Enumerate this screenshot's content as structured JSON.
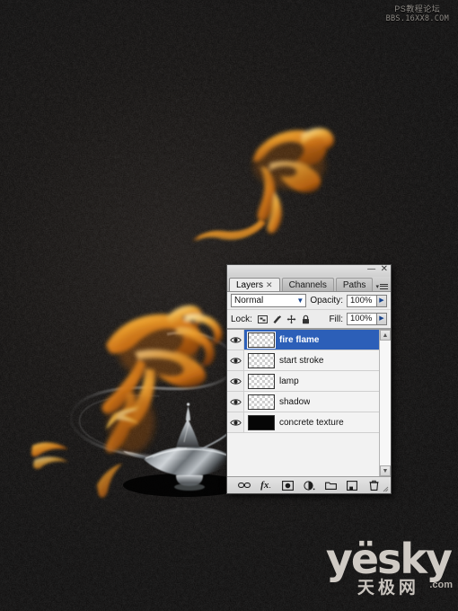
{
  "artwork": {
    "title": "Genie lamp with fire flames composition",
    "background_color": "#0a0807",
    "flame_colors": [
      "#f7c05a",
      "#e8952a",
      "#c96c14",
      "#7a3c08"
    ],
    "lamp_color": "#b9bcc0",
    "stroke_color": "#5a5a5a"
  },
  "watermark_top": {
    "line1": "PS教程论坛",
    "line2": "BBS.16XX8.COM"
  },
  "watermark_logo": {
    "brand": "yësky",
    "suffix": ".com",
    "chinese": "天极网"
  },
  "panel": {
    "window_controls": {
      "minimize": "—",
      "close": "✕"
    },
    "tabs": [
      {
        "label": "Layers",
        "active": true,
        "closable": true,
        "close_glyph": "✕"
      },
      {
        "label": "Channels",
        "active": false,
        "closable": false
      },
      {
        "label": "Paths",
        "active": false,
        "closable": false
      }
    ],
    "menu_icon": "panel-menu-icon",
    "blend_mode": {
      "value": "Normal",
      "dropdown_glyph": "▼"
    },
    "opacity": {
      "label": "Opacity:",
      "value": "100%",
      "spinner_glyph": "▶"
    },
    "lock": {
      "label": "Lock:",
      "icons": [
        {
          "name": "lock-transparent-pixels-icon"
        },
        {
          "name": "lock-image-pixels-icon"
        },
        {
          "name": "lock-position-icon"
        },
        {
          "name": "lock-all-icon"
        }
      ]
    },
    "fill": {
      "label": "Fill:",
      "value": "100%",
      "spinner_glyph": "▶"
    },
    "layers": [
      {
        "name": "fire flame",
        "visible": true,
        "selected": true,
        "thumb": "transparent"
      },
      {
        "name": "start stroke",
        "visible": true,
        "selected": false,
        "thumb": "transparent"
      },
      {
        "name": "lamp",
        "visible": true,
        "selected": false,
        "thumb": "transparent"
      },
      {
        "name": "shadow",
        "visible": true,
        "selected": false,
        "thumb": "transparent"
      },
      {
        "name": "concrete texture",
        "visible": true,
        "selected": false,
        "thumb": "black"
      }
    ],
    "scrollbar": {
      "up_glyph": "▲",
      "down_glyph": "▼"
    },
    "footer_buttons": [
      {
        "name": "link-layers-icon",
        "glyph": ""
      },
      {
        "name": "layer-style-fx-icon",
        "glyph": ""
      },
      {
        "name": "add-layer-mask-icon",
        "glyph": ""
      },
      {
        "name": "new-adjustment-layer-icon",
        "glyph": ""
      },
      {
        "name": "new-group-icon",
        "glyph": ""
      },
      {
        "name": "new-layer-icon",
        "glyph": ""
      },
      {
        "name": "delete-layer-icon",
        "glyph": ""
      }
    ]
  }
}
